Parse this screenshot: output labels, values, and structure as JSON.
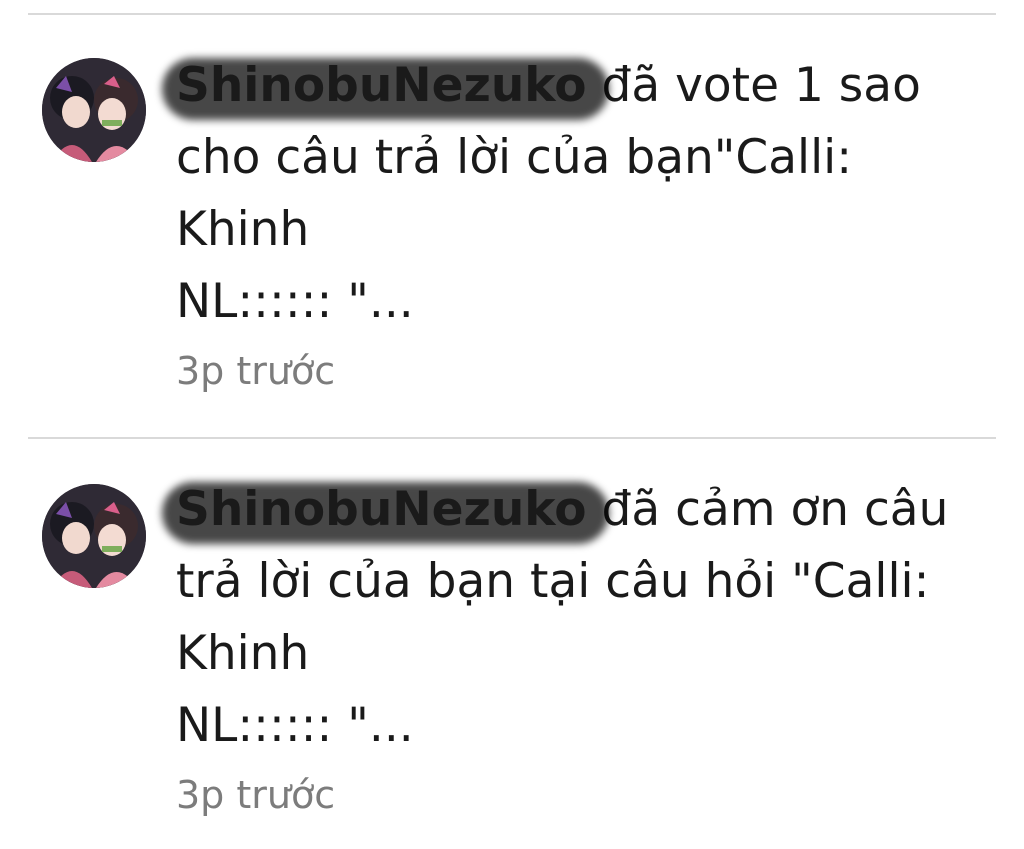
{
  "notifications": [
    {
      "username": "ShinobuNezuko",
      "action": " đã vote 1 sao",
      "line2": "cho câu trả lời của bạn\"Calli:",
      "line3": "Khinh",
      "line4": "NL:::::: \"...",
      "time": "3p trước"
    },
    {
      "username": "ShinobuNezuko",
      "action": " đã cảm ơn câu",
      "line2": "trả lời của bạn tại câu hỏi \"Calli:",
      "line3": "Khinh",
      "line4": "NL:::::: \"...",
      "time": "3p trước"
    }
  ],
  "colors": {
    "divider": "#d9d9d9",
    "time_text": "#7c7c7c",
    "main_text": "#1a1a1a",
    "username_redaction": "#000000"
  }
}
